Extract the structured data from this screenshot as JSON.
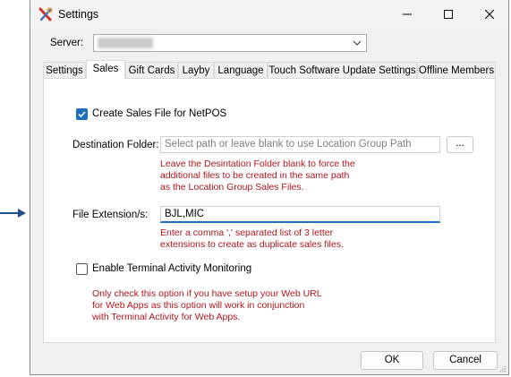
{
  "window": {
    "title": "Settings"
  },
  "server": {
    "label": "Server:",
    "value": "server"
  },
  "tabs": [
    {
      "label": "Settings",
      "active": false
    },
    {
      "label": "Sales",
      "active": true
    },
    {
      "label": "Gift Cards",
      "active": false
    },
    {
      "label": "Layby",
      "active": false
    },
    {
      "label": "Language",
      "active": false
    },
    {
      "label": "Touch Software Update Settings",
      "active": false
    },
    {
      "label": "Offline Members",
      "active": false
    }
  ],
  "sales": {
    "create_sales_file": {
      "label": "Create Sales File for NetPOS",
      "checked": true
    },
    "destination": {
      "label": "Destination Folder:",
      "placeholder": "Select path or leave blank to use Location Group Path",
      "browse_label": "...",
      "note": "Leave the Desintation Folder blank to force the\nadditional files to be created in the same path\nas the Location Group Sales Files."
    },
    "file_extension": {
      "label": "File Extension/s:",
      "value": "BJL,MIC",
      "note": "Enter a comma ',' separated list of 3 letter\nextensions to create as duplicate sales files."
    },
    "terminal_monitoring": {
      "label": "Enable Terminal Activity Monitoring",
      "checked": false,
      "note": "Only check this option if you have setup your Web URL\nfor Web Apps as this option will work in conjunction\nwith Terminal Activity for Web Apps."
    }
  },
  "buttons": {
    "ok": "OK",
    "cancel": "Cancel"
  },
  "colors": {
    "accent": "#1f6fbf",
    "note": "#b0171c",
    "arrow": "#1f4f8a"
  },
  "icons": [
    "settings-app-icon",
    "minimize-icon",
    "maximize-icon",
    "close-icon",
    "chevron-down-icon",
    "checkmark-icon",
    "pointer-arrow-icon",
    "resize-grip-icon"
  ]
}
